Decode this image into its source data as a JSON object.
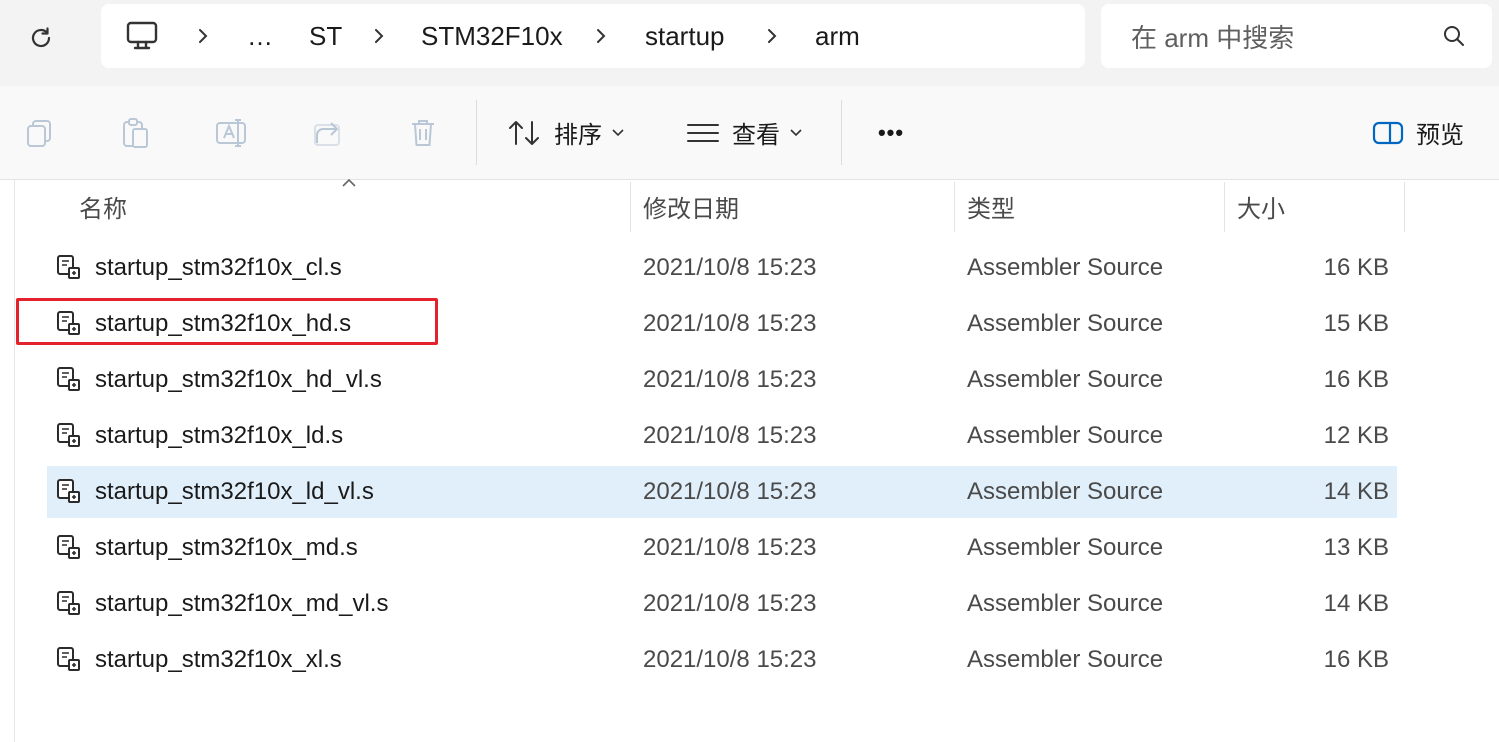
{
  "address": {
    "crumbs": [
      "…",
      "ST",
      "STM32F10x",
      "startup",
      "arm"
    ]
  },
  "search": {
    "placeholder": "在 arm 中搜索"
  },
  "toolbar": {
    "sort_label": "排序",
    "view_label": "查看",
    "more_label": "•••",
    "preview_label": "预览"
  },
  "columns": {
    "name": "名称",
    "date": "修改日期",
    "type": "类型",
    "size": "大小"
  },
  "files": [
    {
      "name": "startup_stm32f10x_cl.s",
      "date": "2021/10/8 15:23",
      "type": "Assembler Source",
      "size": "16 KB"
    },
    {
      "name": "startup_stm32f10x_hd.s",
      "date": "2021/10/8 15:23",
      "type": "Assembler Source",
      "size": "15 KB"
    },
    {
      "name": "startup_stm32f10x_hd_vl.s",
      "date": "2021/10/8 15:23",
      "type": "Assembler Source",
      "size": "16 KB"
    },
    {
      "name": "startup_stm32f10x_ld.s",
      "date": "2021/10/8 15:23",
      "type": "Assembler Source",
      "size": "12 KB"
    },
    {
      "name": "startup_stm32f10x_ld_vl.s",
      "date": "2021/10/8 15:23",
      "type": "Assembler Source",
      "size": "14 KB"
    },
    {
      "name": "startup_stm32f10x_md.s",
      "date": "2021/10/8 15:23",
      "type": "Assembler Source",
      "size": "13 KB"
    },
    {
      "name": "startup_stm32f10x_md_vl.s",
      "date": "2021/10/8 15:23",
      "type": "Assembler Source",
      "size": "14 KB"
    },
    {
      "name": "startup_stm32f10x_xl.s",
      "date": "2021/10/8 15:23",
      "type": "Assembler Source",
      "size": "16 KB"
    }
  ],
  "selected_file": "startup_stm32f10x_ld_vl.s",
  "highlighted_file": "startup_stm32f10x_hd.s",
  "colors": {
    "selection": "#e1effa",
    "highlight_border": "#e3222e",
    "accent": "#0067c0"
  }
}
